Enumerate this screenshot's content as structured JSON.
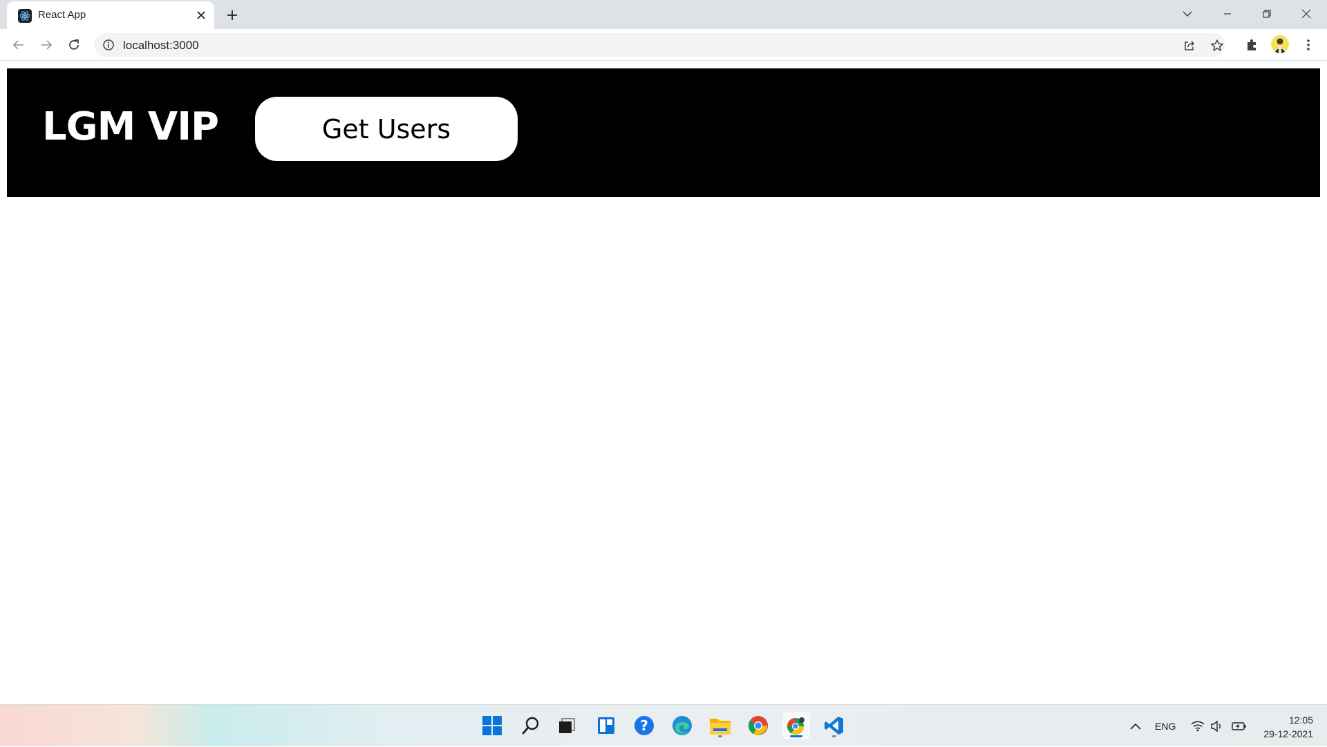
{
  "browser": {
    "tab": {
      "title": "React App",
      "favicon": "react-logo-icon"
    },
    "address": {
      "url": "localhost:3000"
    },
    "window_controls": [
      "tab-search-icon",
      "minimize-icon",
      "restore-icon",
      "close-icon"
    ]
  },
  "page": {
    "brand": "LGM VIP",
    "button_label": "Get Users"
  },
  "taskbar": {
    "apps": [
      "start-icon",
      "search-icon",
      "task-view-icon",
      "widgets-icon",
      "help-icon",
      "edge-icon",
      "file-explorer-icon",
      "chrome-icon",
      "chrome-dev-icon",
      "vscode-icon"
    ],
    "tray": {
      "language": "ENG",
      "time": "12:05",
      "date": "29-12-2021"
    }
  },
  "colors": {
    "header_bg": "#000000",
    "button_bg": "#ffffff",
    "accent": "#0078d4"
  }
}
